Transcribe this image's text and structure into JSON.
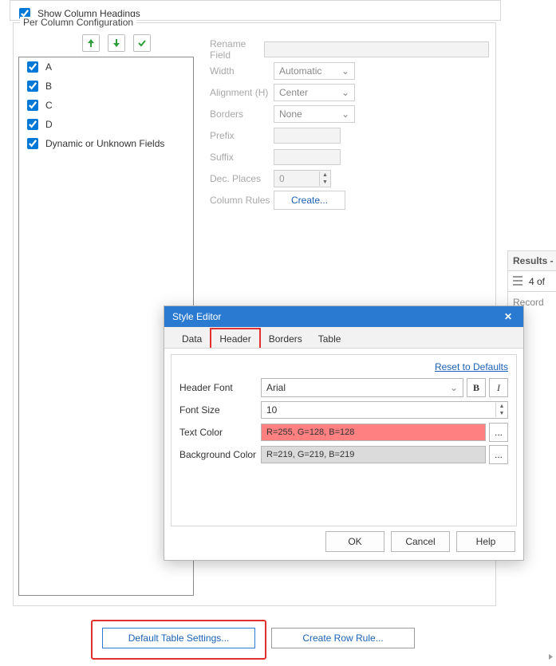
{
  "top_checkbox": {
    "label": "Show Column Headings",
    "checked": true
  },
  "fieldset_title": "Per Column Configuration",
  "columns": [
    {
      "label": "A",
      "checked": true
    },
    {
      "label": "B",
      "checked": true
    },
    {
      "label": "C",
      "checked": true
    },
    {
      "label": "D",
      "checked": true
    },
    {
      "label": "Dynamic or Unknown Fields",
      "checked": true
    }
  ],
  "props": {
    "rename_label": "Rename Field",
    "width_label": "Width",
    "width_value": "Automatic",
    "align_label": "Alignment (H)",
    "align_value": "Center",
    "borders_label": "Borders",
    "borders_value": "None",
    "prefix_label": "Prefix",
    "suffix_label": "Suffix",
    "dec_label": "Dec. Places",
    "dec_value": "0",
    "rules_label": "Column Rules",
    "create_label": "Create..."
  },
  "footer": {
    "default_btn": "Default Table Settings...",
    "row_btn": "Create Row Rule..."
  },
  "right": {
    "results_label": "Results - T",
    "count_label": "4 of",
    "records_label": "Record"
  },
  "modal": {
    "title": "Style Editor",
    "tabs": {
      "data": "Data",
      "header": "Header",
      "borders": "Borders",
      "table": "Table"
    },
    "reset_label": "Reset to Defaults",
    "header_font_label": "Header Font",
    "header_font_value": "Arial",
    "font_size_label": "Font Size",
    "font_size_value": "10",
    "text_color_label": "Text Color",
    "text_color_value": "R=255, G=128, B=128",
    "text_color_hex": "#ff8080",
    "bg_color_label": "Background Color",
    "bg_color_value": "R=219, G=219, B=219",
    "bg_color_hex": "#dbdbdb",
    "ok": "OK",
    "cancel": "Cancel",
    "help": "Help",
    "ellipsis": "..."
  }
}
